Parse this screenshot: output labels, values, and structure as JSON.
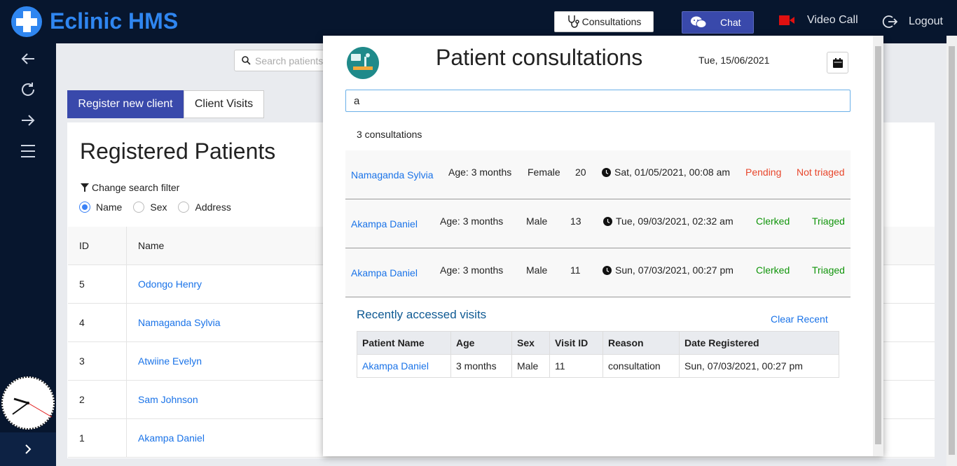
{
  "app": {
    "brand": "Eclinic HMS",
    "consultations_label": "Consultations",
    "chat_label": "Chat",
    "video_label": "Video Call",
    "logout_label": "Logout"
  },
  "sidebar": {
    "icons": [
      "arrow-left-icon",
      "refresh-icon",
      "arrow-right-icon",
      "menu-icon",
      "clock-icon",
      "chevron-right-icon"
    ]
  },
  "main": {
    "search_placeholder": "Search patients",
    "tabs": [
      {
        "label": "Register new client"
      },
      {
        "label": "Client Visits"
      }
    ],
    "title": "Registered Patients",
    "filter_label": "Change search filter",
    "filters": [
      {
        "label": "Name",
        "selected": true
      },
      {
        "label": "Sex",
        "selected": false
      },
      {
        "label": "Address",
        "selected": false
      }
    ],
    "table": {
      "headers": [
        "ID",
        "Name"
      ],
      "rows": [
        {
          "id": "5",
          "name": "Odongo Henry"
        },
        {
          "id": "4",
          "name": "Namaganda Sylvia"
        },
        {
          "id": "3",
          "name": "Atwiine Evelyn"
        },
        {
          "id": "2",
          "name": "Sam Johnson"
        },
        {
          "id": "1",
          "name": "Akampa Daniel"
        }
      ]
    }
  },
  "modal": {
    "title": "Patient consultations",
    "date": "Tue, 15/06/2021",
    "search_value": "a",
    "count_text": "3 consultations",
    "consultations": [
      {
        "name": "Namaganda Sylvia",
        "age": "Age: 3 months",
        "sex": "Female",
        "id": "20",
        "date": "Sat, 01/05/2021, 00:08 am",
        "status": "Pending",
        "triage": "Not triaged"
      },
      {
        "name": "Akampa Daniel",
        "age": "Age: 3 months",
        "sex": "Male",
        "id": "13",
        "date": "Tue, 09/03/2021, 02:32 am",
        "status": "Clerked",
        "triage": "Triaged"
      },
      {
        "name": "Akampa Daniel",
        "age": "Age: 3 months",
        "sex": "Male",
        "id": "11",
        "date": "Sun, 07/03/2021, 00:27 pm",
        "status": "Clerked",
        "triage": "Triaged"
      }
    ],
    "recent": {
      "title": "Recently accessed visits",
      "clear_label": "Clear Recent",
      "headers": [
        "Patient Name",
        "Age",
        "Sex",
        "Visit ID",
        "Reason",
        "Date Registered"
      ],
      "rows": [
        [
          "Akampa Daniel",
          "3 months",
          "Male",
          "11",
          "consultation",
          "Sun, 07/03/2021, 00:27 pm"
        ]
      ]
    }
  },
  "colors": {
    "topbar": "#07162e",
    "brand": "#2f86f0",
    "primary": "#3949ab",
    "link": "#1a73e8",
    "pending": "#e8462b",
    "clerked": "#11950b"
  }
}
